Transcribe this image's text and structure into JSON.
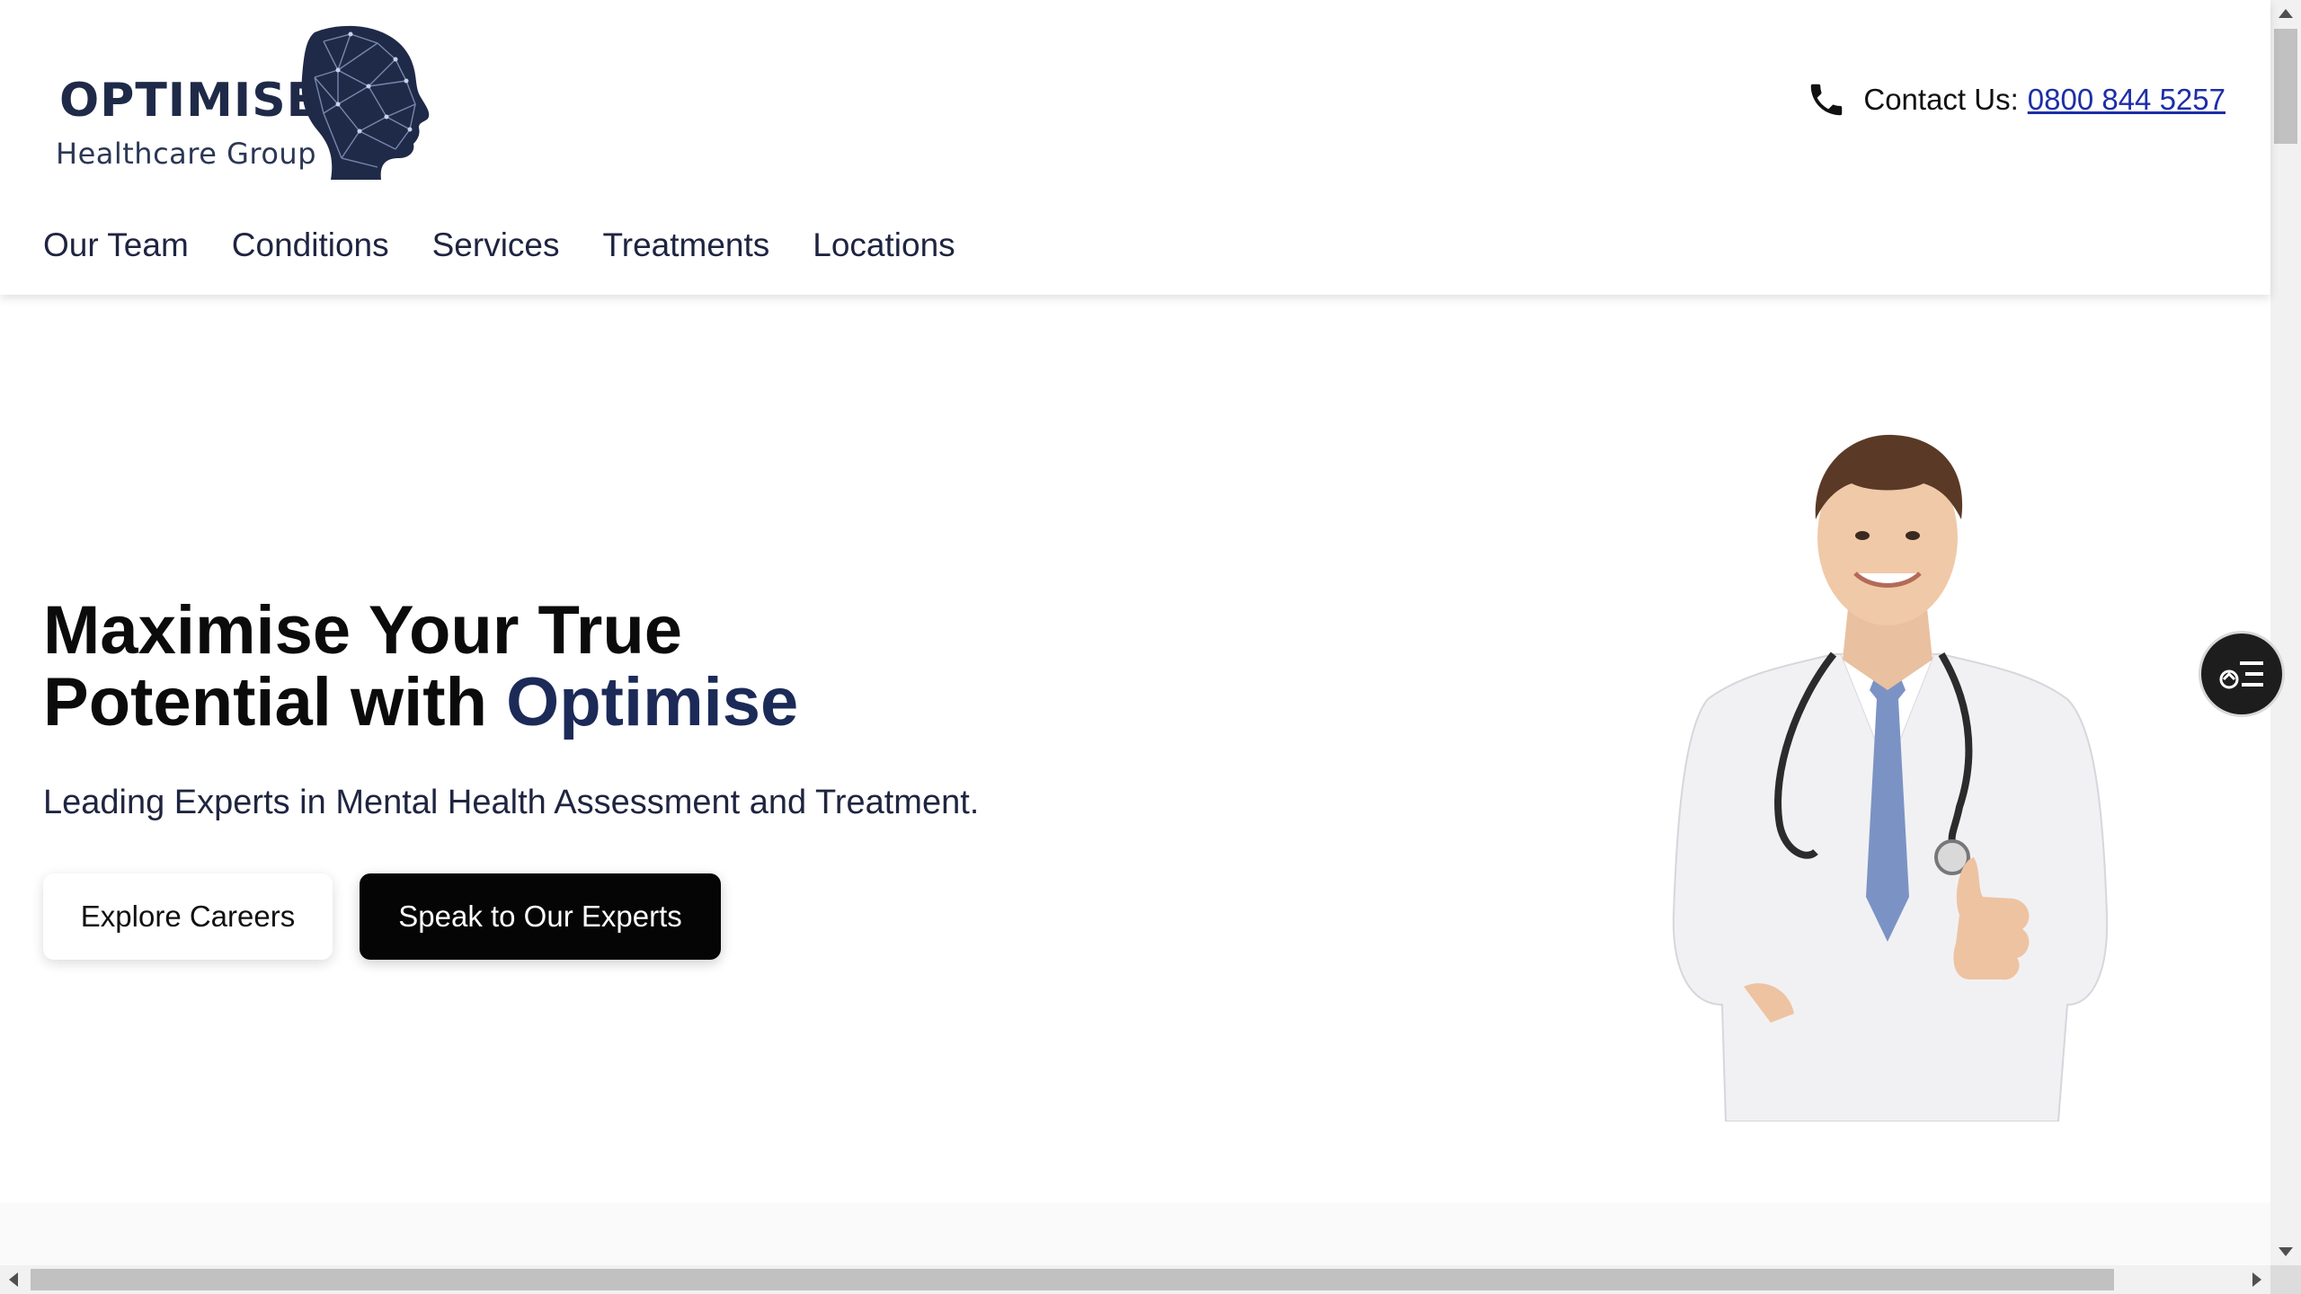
{
  "brand": {
    "name": "OPTIMISE",
    "tagline": "Healthcare Group",
    "color": "#1f2a48"
  },
  "contact": {
    "label": "Contact Us:",
    "phone": "0800 844 5257",
    "icon": "phone-icon"
  },
  "nav": {
    "items": [
      {
        "label": "Our Team"
      },
      {
        "label": "Conditions"
      },
      {
        "label": "Services"
      },
      {
        "label": "Treatments"
      },
      {
        "label": "Locations"
      }
    ]
  },
  "hero": {
    "title_line1": "Maximise Your True",
    "title_line2_prefix": "Potential with ",
    "title_line2_accent": "Optimise",
    "subtitle": "Leading Experts in Mental Health Assessment and Treatment.",
    "btn_secondary": "Explore Careers",
    "btn_primary": "Speak to Our Experts",
    "accent_color": "#1c2a58",
    "image": "doctor-thumbs-up-photo"
  },
  "floating_widget": {
    "icon": "accessibility-menu-icon"
  }
}
